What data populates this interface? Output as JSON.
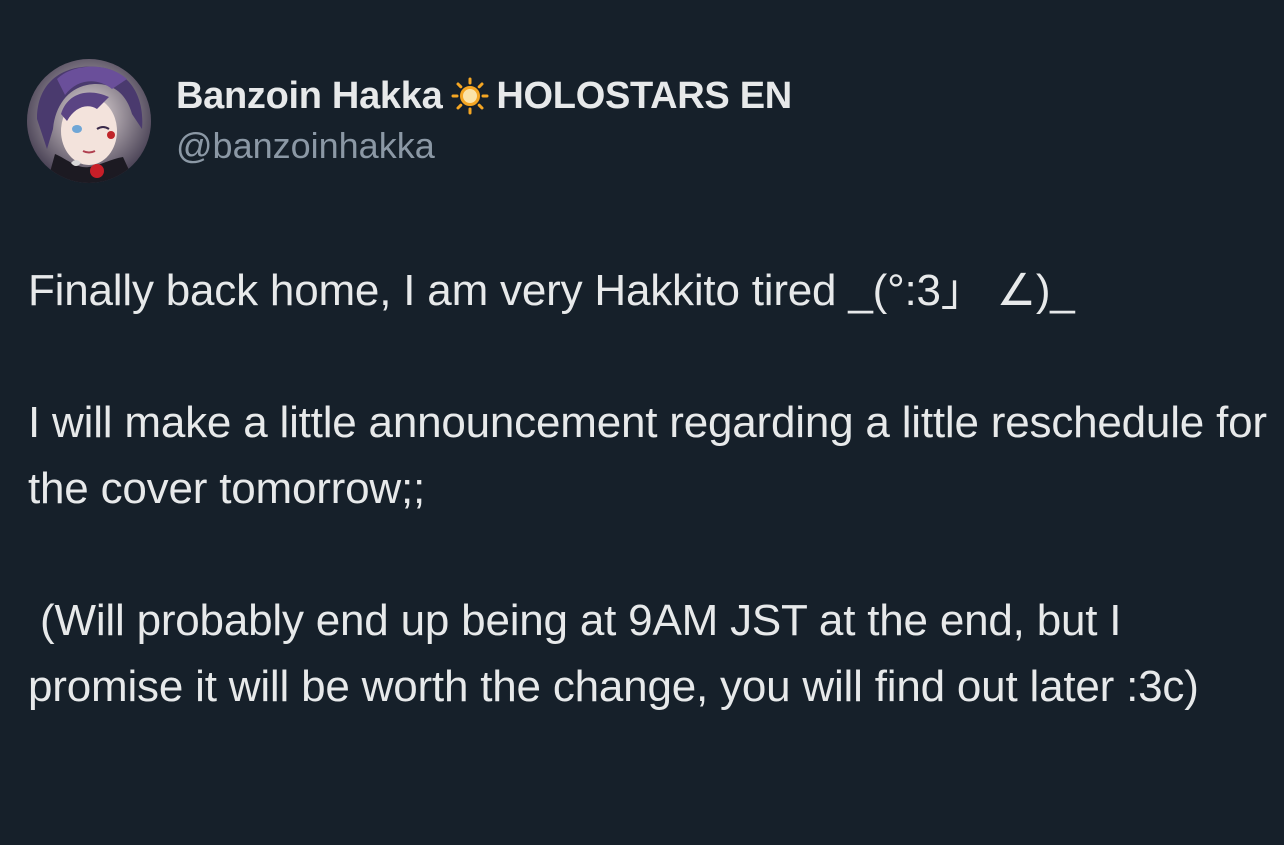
{
  "author": {
    "display_name": "Banzoin Hakka",
    "affiliation": "HOLOSTARS EN",
    "handle": "@banzoinhakka",
    "badge_icon": "sun-icon",
    "badge_color": "#f5a623"
  },
  "tweet": {
    "paragraphs": [
      "Finally back home, I am very Hakkito tired _(°:3」 ∠)_",
      "I will make a little announcement regarding a little reschedule for the cover tomorrow;;",
      " (Will probably end up being at 9AM JST at the end, but I promise it will be worth the change, you will find out later :3c)"
    ]
  },
  "colors": {
    "background": "#16202a",
    "text_primary": "#e7e9ea",
    "text_secondary": "#8b98a5"
  }
}
